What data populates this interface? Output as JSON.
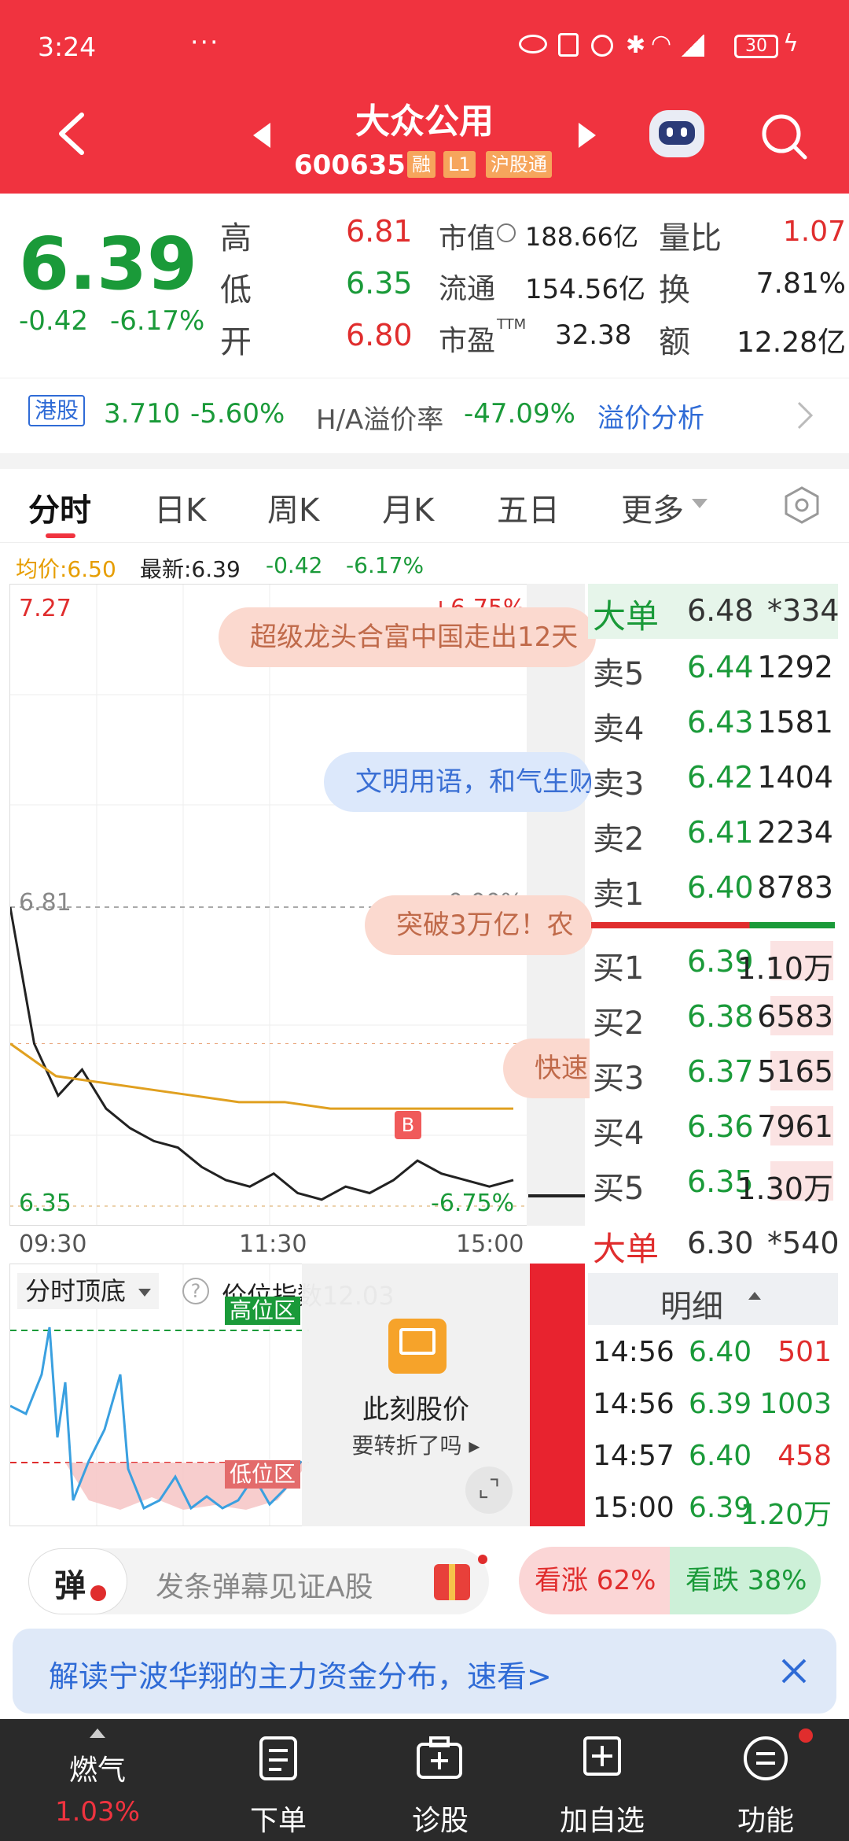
{
  "status_bar": {
    "time": "3:24",
    "battery": "30",
    "more": "···"
  },
  "header": {
    "title": "大众公用",
    "code": "600635",
    "tags": [
      "融",
      "L1",
      "沪股通"
    ]
  },
  "quote": {
    "price": "6.39",
    "change": "-0.42",
    "change_pct": "-6.17%",
    "high_label": "高",
    "high": "6.81",
    "low_label": "低",
    "low": "6.35",
    "open_label": "开",
    "open": "6.80",
    "mcap_label": "市值",
    "mcap": "188.66亿",
    "float_label": "流通",
    "float": "154.56亿",
    "pe_label": "市盈",
    "pe_sup": "TTM",
    "pe": "32.38",
    "vr_label": "量比",
    "vr": "1.07",
    "turn_label": "换",
    "turn": "7.81%",
    "amt_label": "额",
    "amt": "12.28亿"
  },
  "hk": {
    "tag": "港股",
    "price": "3.710",
    "pct": "-5.60%",
    "prem_label": "H/A溢价率",
    "prem": "-47.09%",
    "link": "溢价分析"
  },
  "tabs": [
    "分时",
    "日K",
    "周K",
    "月K",
    "五日",
    "更多"
  ],
  "chart_info": {
    "avg": "均价:6.50",
    "latest": "最新:6.39",
    "chg": "-0.42",
    "pct": "-6.17%"
  },
  "chart_data": {
    "type": "line",
    "x_ticks": [
      "09:30",
      "11:30",
      "15:00"
    ],
    "y_top": "7.27",
    "y_top_pct": "+6.75%",
    "y_mid": "6.81",
    "y_mid_pct": "0.00%",
    "y_bottom": "6.35",
    "y_bottom_pct": "-6.75%",
    "ylim": [
      6.35,
      7.27
    ],
    "series": [
      {
        "values": [
          6.81,
          6.6,
          6.52,
          6.56,
          6.5,
          6.47,
          6.45,
          6.44,
          6.41,
          6.39,
          6.38,
          6.4,
          6.37,
          6.36,
          6.38,
          6.37,
          6.39,
          6.42,
          6.4,
          6.39,
          6.38,
          6.39
        ]
      },
      {
        "values": [
          6.6,
          6.55,
          6.54,
          6.53,
          6.52,
          6.51,
          6.51,
          6.5,
          6.5,
          6.5,
          6.5,
          6.5
        ]
      }
    ],
    "marker": "B",
    "bubbles": [
      "超级龙头合富中国走出12天",
      "文明用语，和气生财",
      "突破3万亿！农",
      "快速"
    ]
  },
  "orderbook": {
    "big_sell": {
      "label": "大单",
      "price": "6.48",
      "vol": "*334"
    },
    "asks": [
      {
        "label": "卖5",
        "price": "6.44",
        "vol": "1292"
      },
      {
        "label": "卖4",
        "price": "6.43",
        "vol": "1581"
      },
      {
        "label": "卖3",
        "price": "6.42",
        "vol": "1404"
      },
      {
        "label": "卖2",
        "price": "6.41",
        "vol": "2234"
      },
      {
        "label": "卖1",
        "price": "6.40",
        "vol": "8783"
      }
    ],
    "bids": [
      {
        "label": "买1",
        "price": "6.39",
        "vol": "1.10万"
      },
      {
        "label": "买2",
        "price": "6.38",
        "vol": "6583"
      },
      {
        "label": "买3",
        "price": "6.37",
        "vol": "5165"
      },
      {
        "label": "买4",
        "price": "6.36",
        "vol": "7961"
      },
      {
        "label": "买5",
        "price": "6.35",
        "vol": "1.30万"
      }
    ],
    "big_buy": {
      "label": "大单",
      "price": "6.30",
      "vol": "*540"
    },
    "detail_title": "明细",
    "ticks": [
      {
        "time": "14:56",
        "price": "6.40",
        "vol": "501"
      },
      {
        "time": "14:56",
        "price": "6.39",
        "vol": "1003"
      },
      {
        "time": "14:57",
        "price": "6.40",
        "vol": "458"
      },
      {
        "time": "15:00",
        "price": "6.39",
        "vol": "1.20万"
      }
    ]
  },
  "indicator": {
    "select": "分时顶底",
    "index_label": "价位指数12.03",
    "high_zone": "高位区",
    "low_zone": "低位区",
    "promo_title": "此刻股价",
    "promo_sub": "要转折了吗"
  },
  "danmaku": {
    "btn": "弹",
    "placeholder": "发条弹幕见证A股",
    "up": "看涨 62%",
    "down": "看跌 38%"
  },
  "banner": {
    "text": "解读宁波华翔的主力资金分布，速看>"
  },
  "bottom_nav": {
    "sector": "燃气",
    "sector_pct": "1.03%",
    "items": [
      "下单",
      "诊股",
      "加自选",
      "功能"
    ]
  },
  "colors": {
    "brand": "#f0333f",
    "up": "#e02d2d",
    "down": "#1a9a39"
  }
}
